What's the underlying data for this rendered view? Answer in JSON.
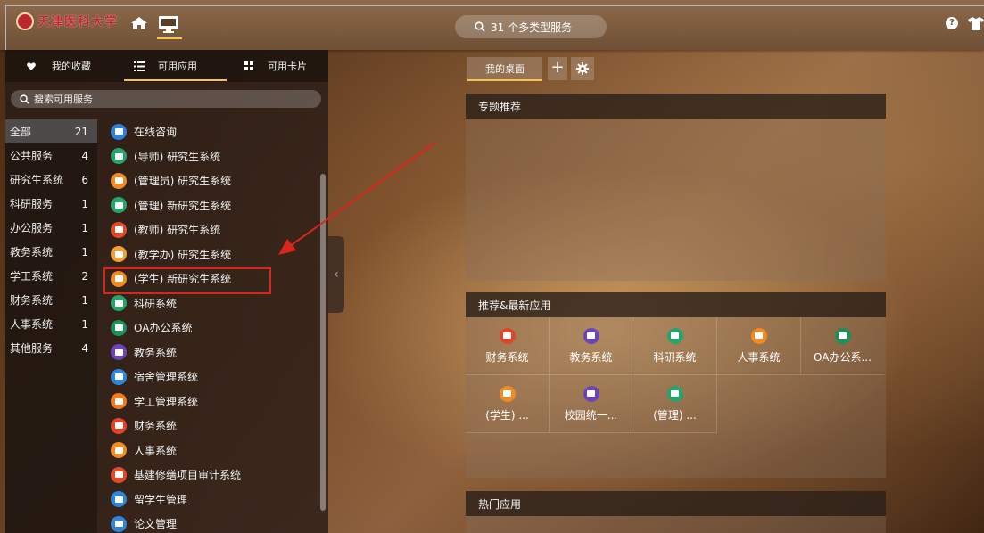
{
  "topbar": {
    "logo_text": "天津医科大学",
    "search_text": "31 个多类型服务",
    "icons": [
      "home-icon",
      "desktop-icon",
      "search-icon",
      "help-icon",
      "shirt-icon"
    ]
  },
  "left": {
    "tabs": [
      {
        "label": "我的收藏",
        "icon": "heart-icon"
      },
      {
        "label": "可用应用",
        "icon": "list-icon"
      },
      {
        "label": "可用卡片",
        "icon": "grid-icon"
      }
    ],
    "search_placeholder": "搜索可用服务",
    "categories": [
      {
        "name": "全部",
        "count": "21"
      },
      {
        "name": "公共服务",
        "count": "4"
      },
      {
        "name": "研究生系统",
        "count": "6"
      },
      {
        "name": "科研服务",
        "count": "1"
      },
      {
        "name": "办公服务",
        "count": "1"
      },
      {
        "name": "教务系统",
        "count": "1"
      },
      {
        "name": "学工系统",
        "count": "2"
      },
      {
        "name": "财务系统",
        "count": "1"
      },
      {
        "name": "人事系统",
        "count": "1"
      },
      {
        "name": "其他服务",
        "count": "4"
      }
    ],
    "apps": [
      {
        "name": "在线咨询",
        "color": "#2f7fd6"
      },
      {
        "name": "(导师) 研究生系统",
        "color": "#27a36b"
      },
      {
        "name": "(管理员) 研究生系统",
        "color": "#f08a24"
      },
      {
        "name": "(管理) 新研究生系统",
        "color": "#27a36b"
      },
      {
        "name": "(教师) 研究生系统",
        "color": "#e04b2b"
      },
      {
        "name": "(教学办) 研究生系统",
        "color": "#f0a23a"
      },
      {
        "name": "(学生) 新研究生系统",
        "color": "#f08a24"
      },
      {
        "name": "科研系统",
        "color": "#27a36b"
      },
      {
        "name": "OA办公系统",
        "color": "#1f8f5a"
      },
      {
        "name": "教务系统",
        "color": "#6b44b8"
      },
      {
        "name": "宿舍管理系统",
        "color": "#2f86d6"
      },
      {
        "name": "学工管理系统",
        "color": "#f07a20"
      },
      {
        "name": "财务系统",
        "color": "#e0442b"
      },
      {
        "name": "人事系统",
        "color": "#f08a24"
      },
      {
        "name": "基建修缮项目审计系统",
        "color": "#e04b2b"
      },
      {
        "name": "留学生管理",
        "color": "#2f86d6"
      },
      {
        "name": "论文管理",
        "color": "#2f86d6"
      }
    ]
  },
  "desktop": {
    "tab_label": "我的桌面",
    "panels": {
      "topic_title": "专题推荐",
      "recommend_title": "推荐&最新应用",
      "hot_title": "热门应用"
    },
    "recommend_apps": [
      {
        "label": "财务系统",
        "color": "#e0442b"
      },
      {
        "label": "教务系统",
        "color": "#6b44b8"
      },
      {
        "label": "科研系统",
        "color": "#27a36b"
      },
      {
        "label": "人事系统",
        "color": "#f08a24"
      },
      {
        "label": "OA办公系...",
        "color": "#1f8f5a"
      },
      {
        "label": "(学生) ...",
        "color": "#f08a24"
      },
      {
        "label": "校园统一...",
        "color": "#6b44b8"
      },
      {
        "label": "(管理) ...",
        "color": "#27a36b"
      }
    ]
  },
  "colors": {
    "accent": "#f5c44a",
    "highlight_border": "#d9251e",
    "arrow": "#d9251e"
  }
}
